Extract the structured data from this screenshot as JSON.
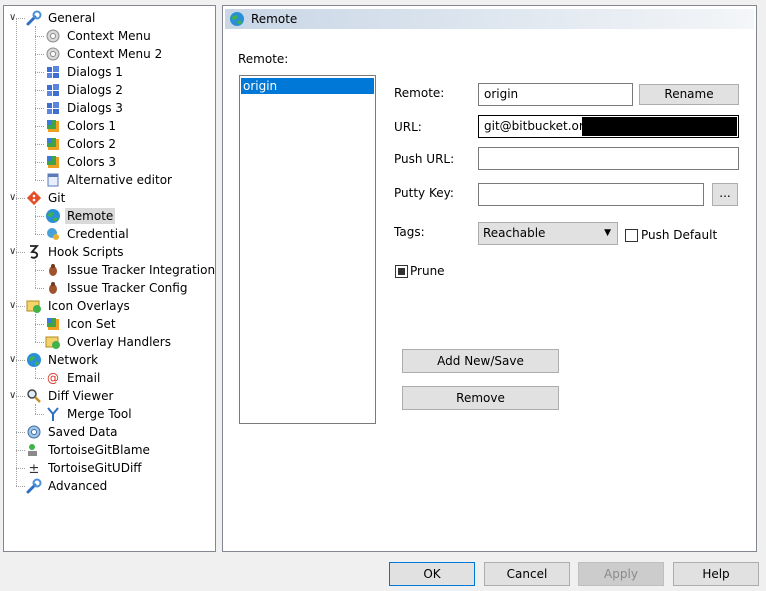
{
  "tree": {
    "items": [
      {
        "label": "General",
        "icon": "wrench-icon",
        "level": 0,
        "expanded": true
      },
      {
        "label": "Context Menu",
        "icon": "gear-icon",
        "level": 1
      },
      {
        "label": "Context Menu 2",
        "icon": "gear-icon",
        "level": 1
      },
      {
        "label": "Dialogs 1",
        "icon": "windows-icon",
        "level": 1
      },
      {
        "label": "Dialogs 2",
        "icon": "windows-icon",
        "level": 1
      },
      {
        "label": "Dialogs 3",
        "icon": "windows-icon",
        "level": 1
      },
      {
        "label": "Colors 1",
        "icon": "palette-icon",
        "level": 1
      },
      {
        "label": "Colors 2",
        "icon": "palette-icon",
        "level": 1
      },
      {
        "label": "Colors 3",
        "icon": "palette-icon",
        "level": 1
      },
      {
        "label": "Alternative editor",
        "icon": "notepad-icon",
        "level": 1
      },
      {
        "label": "Git",
        "icon": "git-icon",
        "level": 0,
        "expanded": true
      },
      {
        "label": "Remote",
        "icon": "globe-icon",
        "level": 1,
        "selected": true
      },
      {
        "label": "Credential",
        "icon": "credential-icon",
        "level": 1
      },
      {
        "label": "Hook Scripts",
        "icon": "hook-icon",
        "level": 0,
        "expanded": true
      },
      {
        "label": "Issue Tracker Integration",
        "icon": "bug-icon",
        "level": 1
      },
      {
        "label": "Issue Tracker Config",
        "icon": "bug-icon",
        "level": 1
      },
      {
        "label": "Icon Overlays",
        "icon": "overlay-icon",
        "level": 0,
        "expanded": true
      },
      {
        "label": "Icon Set",
        "icon": "palette-icon",
        "level": 1
      },
      {
        "label": "Overlay Handlers",
        "icon": "overlay-icon",
        "level": 1
      },
      {
        "label": "Network",
        "icon": "globe-icon",
        "level": 0,
        "expanded": true
      },
      {
        "label": "Email",
        "icon": "at-icon",
        "level": 1
      },
      {
        "label": "Diff Viewer",
        "icon": "magnifier-icon",
        "level": 0,
        "expanded": true
      },
      {
        "label": "Merge Tool",
        "icon": "merge-icon",
        "level": 1
      },
      {
        "label": "Saved Data",
        "icon": "gear-blue-icon",
        "level": 0
      },
      {
        "label": "TortoiseGitBlame",
        "icon": "blame-icon",
        "level": 0
      },
      {
        "label": "TortoiseGitUDiff",
        "icon": "udiff-icon",
        "level": 0
      },
      {
        "label": "Advanced",
        "icon": "wrench-icon",
        "level": 0
      }
    ]
  },
  "panel": {
    "title": "Remote",
    "remote_list_label": "Remote:",
    "remote_list": [
      "origin"
    ],
    "remote_label": "Remote:",
    "remote_value": "origin",
    "rename_label": "Rename",
    "url_label": "URL:",
    "url_value": "git@bitbucket.org:",
    "push_url_label": "Push URL:",
    "push_url_value": "",
    "putty_key_label": "Putty Key:",
    "putty_key_value": "",
    "browse_label": "...",
    "tags_label": "Tags:",
    "tags_value": "Reachable",
    "push_default_label": "Push Default",
    "push_default_checked": false,
    "prune_label": "Prune",
    "prune_checked": true,
    "add_save_label": "Add New/Save",
    "remove_label": "Remove"
  },
  "footer": {
    "ok_label": "OK",
    "cancel_label": "Cancel",
    "apply_label": "Apply",
    "help_label": "Help"
  },
  "colors": {
    "selection": "#0078d7",
    "tree_selected": "#d9d9d9"
  }
}
